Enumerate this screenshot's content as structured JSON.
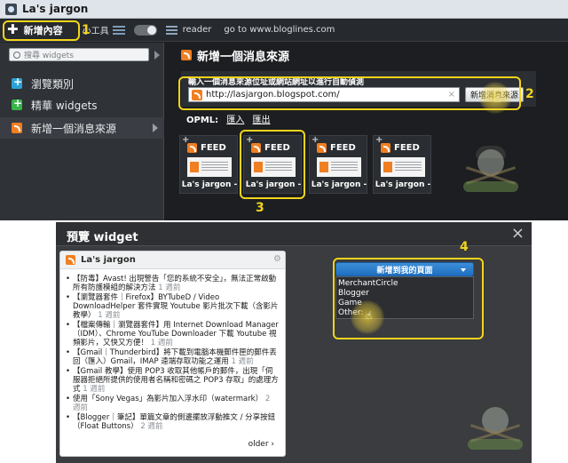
{
  "window": {
    "title": "La's jargon"
  },
  "toolbar": {
    "add_content": "新增內容",
    "tools": "小工具",
    "reader": "reader",
    "goto": "go to www.bloglines.com"
  },
  "sidebar": {
    "search_placeholder": "搜尋 widgets",
    "items": [
      {
        "label": "瀏覽類別"
      },
      {
        "label": "精華 widgets"
      },
      {
        "label": "新增一個消息來源"
      }
    ]
  },
  "main": {
    "title": "新增一個消息來源",
    "url_label": "輸入一個消息來源位址或網站網址以進行自動偵測",
    "url_value": "http://lasjargon.blogspot.com/",
    "clear": "×",
    "add_source_button": "新增消息來源",
    "opml_label": "OPML:",
    "opml_import": "匯入",
    "opml_export": "匯出",
    "feeds": [
      {
        "badge": "FEED",
        "name": "La's jargon -"
      },
      {
        "badge": "FEED",
        "name": "La's jargon -"
      },
      {
        "badge": "FEED",
        "name": "La's jargon -"
      },
      {
        "badge": "FEED",
        "name": "La's jargon -"
      }
    ]
  },
  "markers": [
    "1",
    "2",
    "3",
    "4"
  ],
  "dialog": {
    "title": "預覽 widget",
    "close": "×",
    "widget": {
      "title": "La's jargon",
      "posts": [
        {
          "text": "【防毒】Avast! 出現警告「您的系統不安全」，無法正常啟動所有防護模組的解決方法",
          "age": "1 週前"
        },
        {
          "text": "【瀏覽器套件｜Firefox】BYTubeD / Video DownloadHelper 套件實現 Youtube 影片批次下載（含影片教學）",
          "age": "1 週前"
        },
        {
          "text": "【檔案傳輸｜瀏覽器套件】用 Internet Download Manager（IDM）、Chrome YouTube Downloader 下載 Youtube 視頻影片，又快又方便！",
          "age": "1 週前"
        },
        {
          "text": "【Gmail｜Thunderbird】將下載到電腦本機郵件匣的郵件丟回（匯入）Gmail，IMAP 遠端存取功能之運用",
          "age": "1 週前"
        },
        {
          "text": "【Gmail 教學】使用 POP3 收取其他帳戶的郵件，出現「伺服器拒絕所提供的使用者名稱和密碼之 POP3 存取」的處理方式",
          "age": "1 週前"
        },
        {
          "text": "使用「Sony Vegas」為影片加入浮水印（watermark）",
          "age": "2 週前"
        },
        {
          "text": "【Blogger｜筆記】單篇文章的側邊擺放浮動推文 / 分享按鈕（Float Buttons）",
          "age": "2 週前"
        }
      ],
      "older": "older ›"
    },
    "dropdown": {
      "label": "新增到我的頁面",
      "options": [
        "MerchantCircle",
        "Blogger",
        "Game",
        "Other:"
      ]
    }
  },
  "colors": {
    "highlight": "#f2d41c",
    "rss": "#f07f22",
    "accent_blue": "#1f6fbf"
  }
}
